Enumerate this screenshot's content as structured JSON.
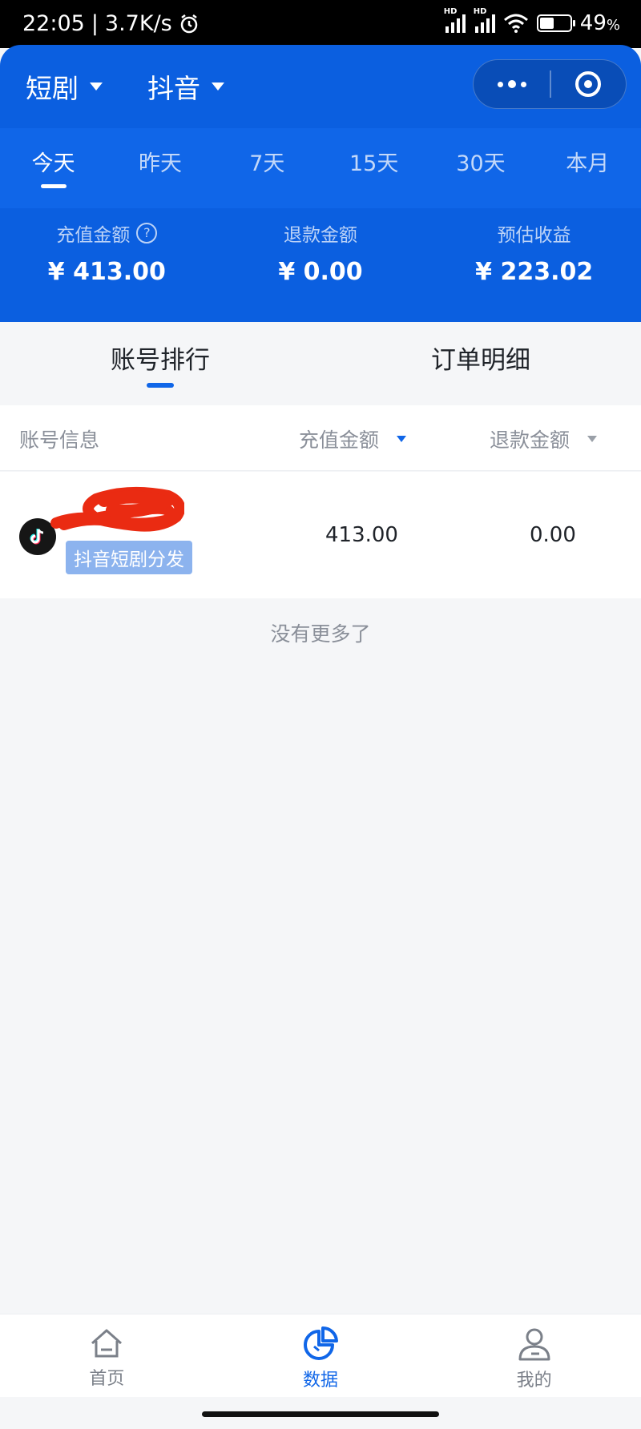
{
  "status_bar": {
    "time": "22:05",
    "net_speed": "3.7K/s",
    "signal_tag": "HD",
    "battery_percent_text": "49",
    "battery_percent_symbol": "%",
    "battery_level": 0.49
  },
  "header": {
    "dropdown_1": "短剧",
    "dropdown_2": "抖音"
  },
  "date_tabs": [
    {
      "label": "今天",
      "active": true
    },
    {
      "label": "昨天",
      "active": false
    },
    {
      "label": "7天",
      "active": false
    },
    {
      "label": "15天",
      "active": false
    },
    {
      "label": "30天",
      "active": false
    },
    {
      "label": "本月",
      "active": false
    }
  ],
  "metrics": [
    {
      "label": "充值金额",
      "value": "¥ 413.00"
    },
    {
      "label": "退款金额",
      "value": "¥ 0.00"
    },
    {
      "label": "预估收益",
      "value": "¥ 223.02"
    }
  ],
  "help_mark": "?",
  "main_tabs": [
    {
      "label": "账号排行",
      "active": true
    },
    {
      "label": "订单明细",
      "active": false
    }
  ],
  "table": {
    "headers": [
      "账号信息",
      "充值金额",
      "退款金额"
    ],
    "rows": [
      {
        "tag": "抖音短剧分发",
        "recharge": "413.00",
        "refund": "0.00"
      }
    ]
  },
  "no_more_text": "没有更多了",
  "tabbar": [
    {
      "label": "首页",
      "icon": "home-icon",
      "active": false
    },
    {
      "label": "数据",
      "icon": "pie-chart-icon",
      "active": true
    },
    {
      "label": "我的",
      "icon": "user-icon",
      "active": false
    }
  ],
  "colors": {
    "primary": "#0b5fe0",
    "tag_bg": "#8cb3ee",
    "redaction": "#ea2b12"
  }
}
